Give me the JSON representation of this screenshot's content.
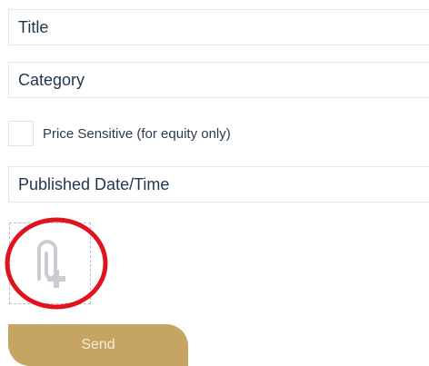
{
  "form": {
    "title_placeholder": "Title",
    "category_placeholder": "Category",
    "price_sensitive_label": "Price Sensitive (for equity only)",
    "published_placeholder": "Published Date/Time",
    "send_label": "Send"
  },
  "colors": {
    "text": "#1f3550",
    "button": "#c5a561",
    "button_text": "#f4ecd8",
    "highlight": "#e0141e"
  },
  "icons": {
    "attach": "paperclip-add-icon"
  }
}
